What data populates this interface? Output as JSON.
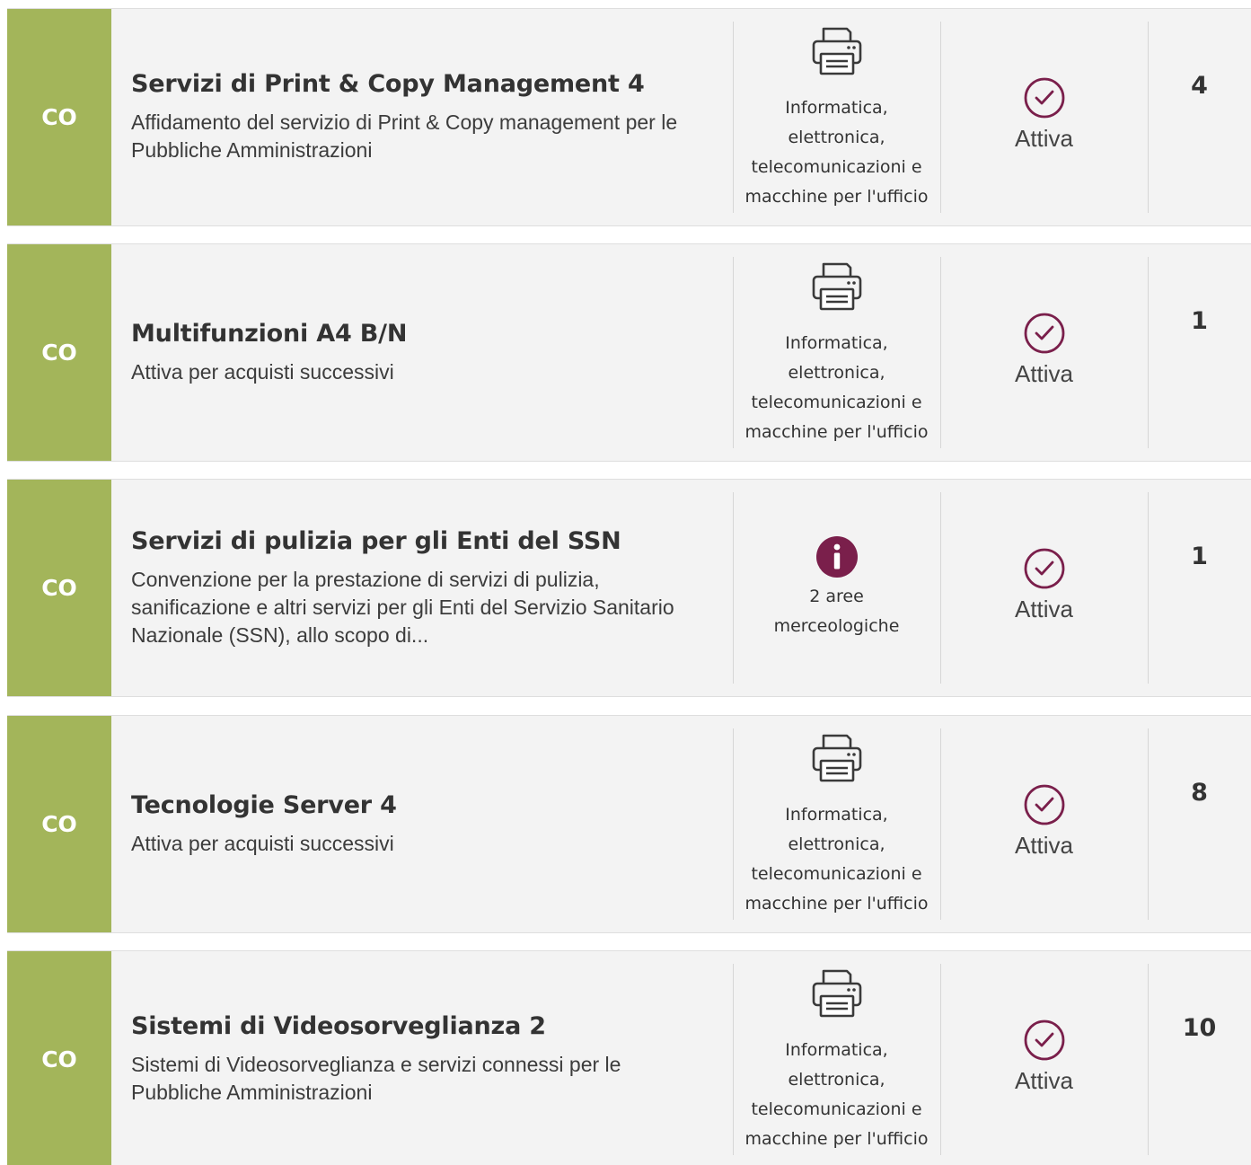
{
  "rows": [
    {
      "badge": "CO",
      "title": "Servizi di Print & Copy Management 4",
      "desc": "Affidamento del servizio di Print & Copy management per le Pubbliche Amministrazioni",
      "category_icon": "printer-icon",
      "category": "Informatica, elettronica, telecomunicazioni e macchine per l'ufficio",
      "status": "Attiva",
      "count": "4"
    },
    {
      "badge": "CO",
      "title": "Multifunzioni A4 B/N",
      "desc": "Attiva per acquisti successivi",
      "category_icon": "printer-icon",
      "category": "Informatica, elettronica, telecomunicazioni e macchine per l'ufficio",
      "status": "Attiva",
      "count": "1"
    },
    {
      "badge": "CO",
      "title": "Servizi di pulizia per gli Enti del SSN",
      "desc": "Convenzione per la prestazione di servizi di pulizia, sanificazione e altri servizi per gli Enti del Servizio Sanitario Nazionale (SSN), allo scopo di...",
      "category_icon": "info-icon",
      "category": "2 aree merceologiche",
      "status": "Attiva",
      "count": "1"
    },
    {
      "badge": "CO",
      "title": "Tecnologie Server 4",
      "desc": "Attiva per acquisti successivi",
      "category_icon": "printer-icon",
      "category": "Informatica, elettronica, telecomunicazioni e macchine per l'ufficio",
      "status": "Attiva",
      "count": "8"
    },
    {
      "badge": "CO",
      "title": "Sistemi di Videosorveglianza 2",
      "desc": "Sistemi di Videosorveglianza e servizi connessi per le Pubbliche Amministrazioni",
      "category_icon": "printer-icon",
      "category": "Informatica, elettronica, telecomunicazioni e macchine per l'ufficio",
      "status": "Attiva",
      "count": "10"
    }
  ],
  "colors": {
    "badge_bg": "#a3b55a",
    "row_bg": "#f3f3f3",
    "accent": "#7a1f4b"
  }
}
